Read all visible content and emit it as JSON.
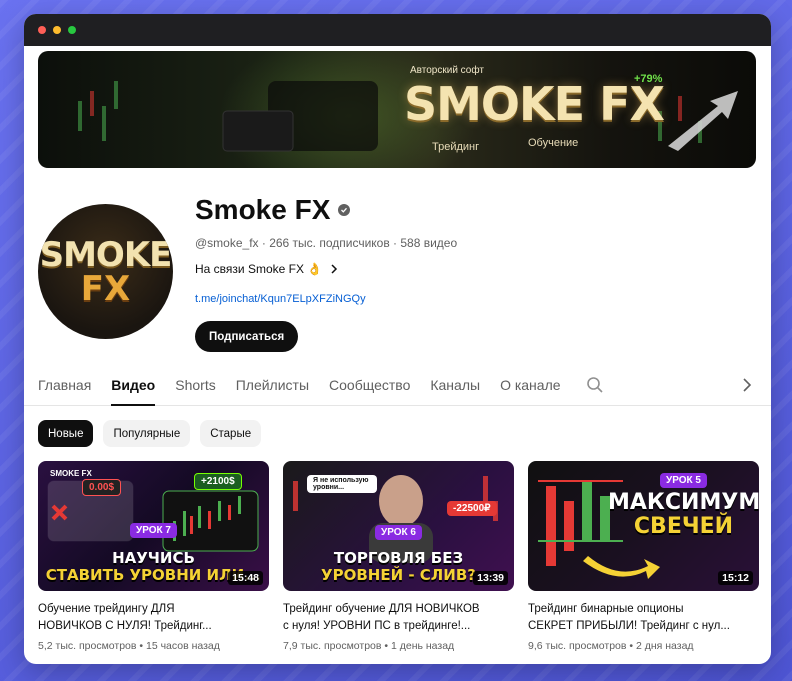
{
  "banner": {
    "subtitle": "Авторский софт",
    "title": "SMOKE FX",
    "left_caption": "Трейдинг",
    "right_caption": "Обучение",
    "percent": "+79%"
  },
  "avatar": {
    "line1": "SMOKE",
    "line2": "FX"
  },
  "channel": {
    "name": "Smoke FX",
    "meta": "@smoke_fx · 266 тыс. подписчиков · 588 видео",
    "description": "На связи Smoke FX 👌",
    "link": "t.me/joinchat/Kqun7ELpXFZiNGQy",
    "subscribe_label": "Подписаться"
  },
  "tabs": [
    {
      "label": "Главная"
    },
    {
      "label": "Видео"
    },
    {
      "label": "Shorts"
    },
    {
      "label": "Плейлисты"
    },
    {
      "label": "Сообщество"
    },
    {
      "label": "Каналы"
    },
    {
      "label": "О канале"
    }
  ],
  "active_tab": "Видео",
  "chips": [
    {
      "label": "Новые"
    },
    {
      "label": "Популярные"
    },
    {
      "label": "Старые"
    }
  ],
  "videos": [
    {
      "thumb_lesson": "УРОК 7",
      "thumb_line1": "НАУЧИСЬ",
      "thumb_line2": "СТАВИТЬ УРОВНИ ИЛИ...",
      "thumb_tag1": "0.00$",
      "thumb_tag2": "+2100$",
      "thumb_brand": "SMOKE FX",
      "duration": "15:48",
      "title_line1": "Обучение трейдингу ДЛЯ",
      "title_line2": "НОВИЧКОВ С НУЛЯ! Трейдинг...",
      "meta": "5,2 тыс. просмотров • 15 часов назад"
    },
    {
      "thumb_lesson": "УРОК 6",
      "thumb_line1": "ТОРГОВЛЯ БЕЗ",
      "thumb_line2": "УРОВНЕЙ - СЛИВ?",
      "thumb_tag1": "Я не использую уровни...",
      "thumb_tag2": "-22500₽",
      "duration": "13:39",
      "title_line1": "Трейдинг обучение ДЛЯ НОВИЧКОВ",
      "title_line2": "с нуля! УРОВНИ ПС в трейдинге!...",
      "meta": "7,9 тыс. просмотров • 1 день назад"
    },
    {
      "thumb_lesson": "УРОК 5",
      "thumb_line1": "МАКСИМУМЫ",
      "thumb_line2": "СВЕЧЕЙ",
      "duration": "15:12",
      "title_line1": "Трейдинг бинарные опционы",
      "title_line2": "СЕКРЕТ ПРИБЫЛИ! Трейдинг с нул...",
      "meta": "9,6 тыс. просмотров • 2 дня назад"
    }
  ],
  "colors": {
    "page_bg": "#5b63e0",
    "link": "#065fd4",
    "accent_purple": "#8a2be2",
    "text_primary": "#0f0f0f",
    "text_secondary": "#606060"
  }
}
